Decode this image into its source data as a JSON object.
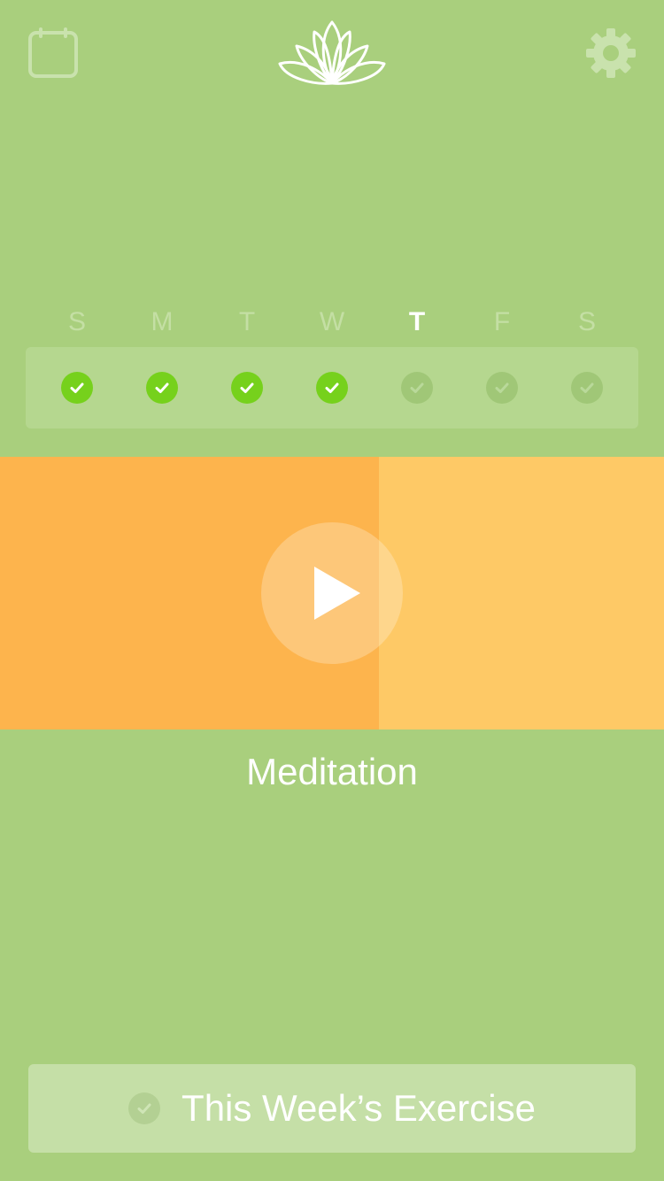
{
  "header": {
    "left_icon": "calendar-icon",
    "center_icon": "lotus-logo-icon",
    "right_icon": "gear-icon"
  },
  "week": {
    "days": [
      {
        "label": "S",
        "done": true,
        "today": false
      },
      {
        "label": "M",
        "done": true,
        "today": false
      },
      {
        "label": "T",
        "done": true,
        "today": false
      },
      {
        "label": "W",
        "done": true,
        "today": false
      },
      {
        "label": "T",
        "done": false,
        "today": true
      },
      {
        "label": "F",
        "done": false,
        "today": false
      },
      {
        "label": "S",
        "done": false,
        "today": false
      }
    ]
  },
  "player": {
    "progress_percent": 57,
    "play_icon": "play-icon",
    "title": "Meditation"
  },
  "footer": {
    "exercise_label": "This Week’s Exercise",
    "exercise_icon": "check-circle-icon"
  },
  "colors": {
    "background": "#a9cf7d",
    "check_done": "#76d11c",
    "check_pending": "#a0c777",
    "progress": "#fdb44d",
    "media_bg": "#fec966"
  }
}
